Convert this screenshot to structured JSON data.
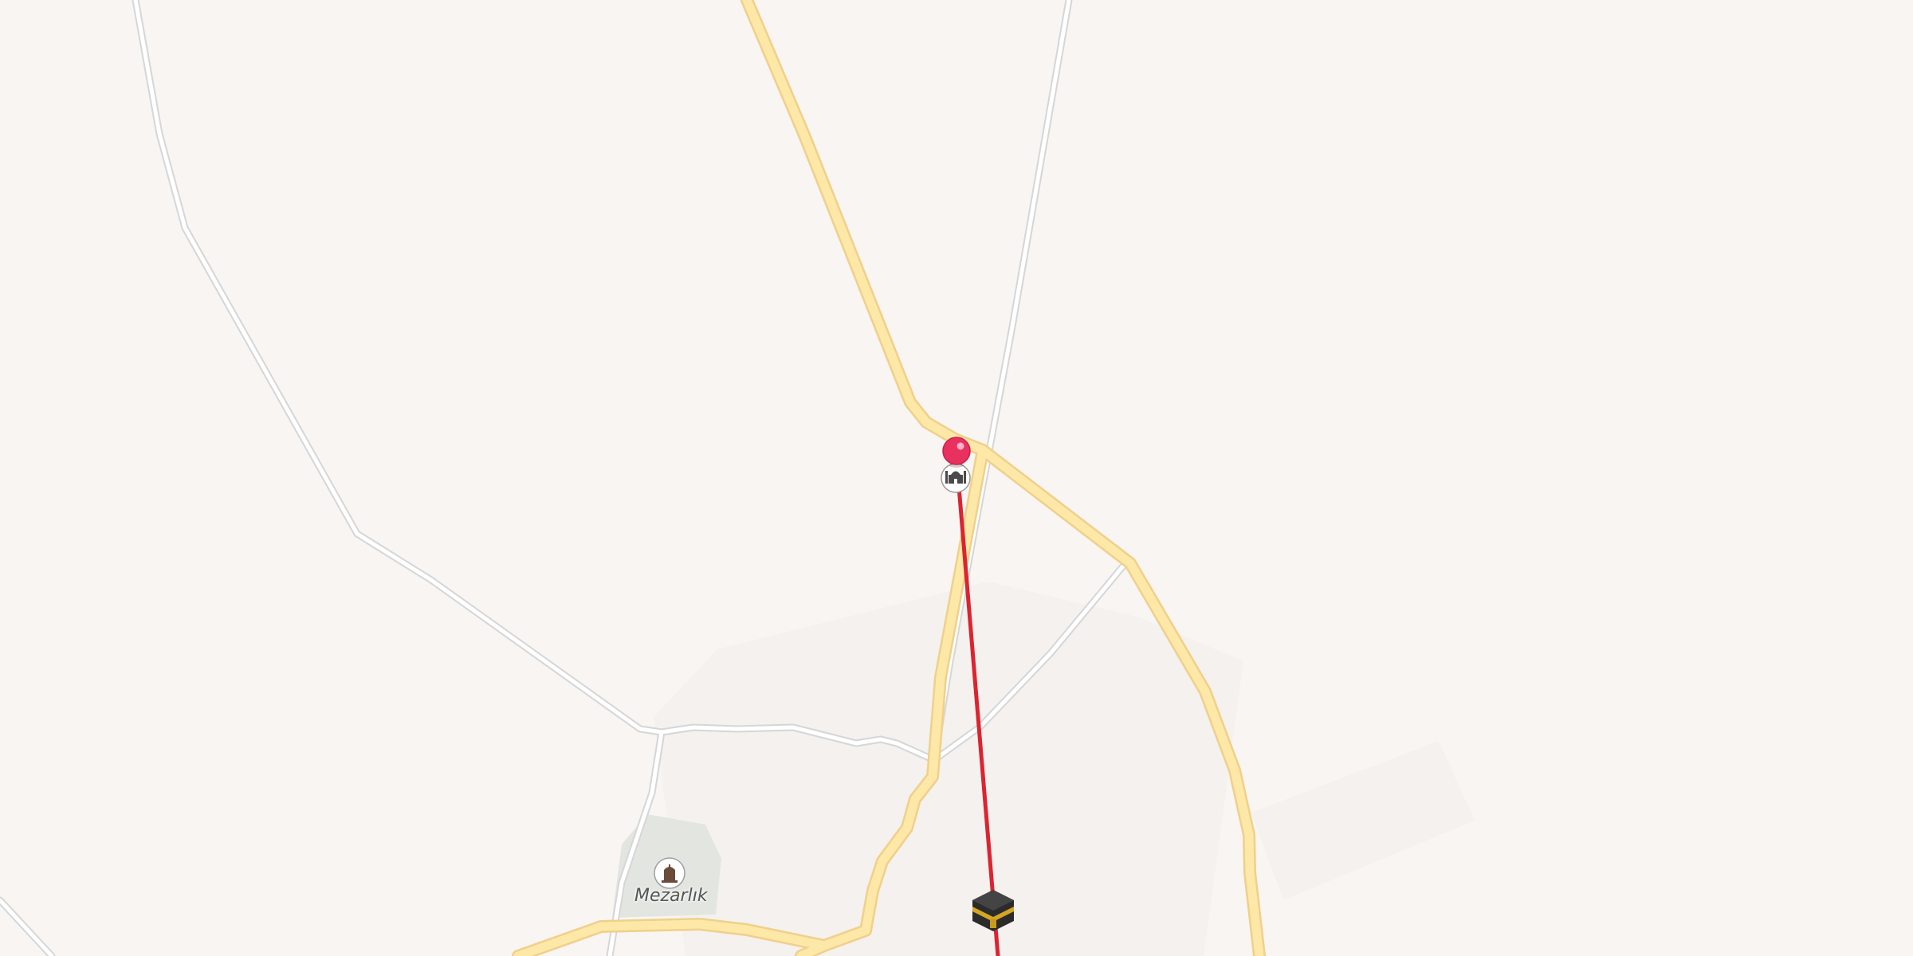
{
  "map": {
    "poi_labels": {
      "cemetery": "Mezarlık"
    },
    "markers": {
      "user_location": "pin",
      "mosque": "mosque-icon",
      "kaaba": "kaaba-icon",
      "cemetery": "cemetery-icon"
    },
    "qibla_line": {
      "color": "#dc2430"
    },
    "colors": {
      "background": "#f8f5f2",
      "major_road": "#fde8a8",
      "major_road_casing": "#f2d28a",
      "minor_road": "#ffffff",
      "minor_road_casing": "#dcdcdc",
      "cemetery_area": "#e3e6e0",
      "pin": "#e8315f"
    }
  }
}
